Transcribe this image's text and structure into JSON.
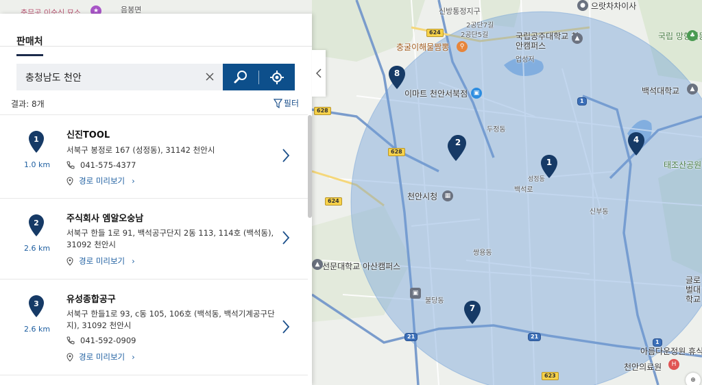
{
  "panel": {
    "tab_label": "판매처",
    "search_value": "충청남도 천안",
    "result_count": "결과: 8개",
    "filter_label": "필터"
  },
  "results": [
    {
      "number": "1",
      "name": "신진TOOL",
      "address": "서북구 봉정로 167 (성정동), 31142 천안시",
      "phone": "041-575-4377",
      "distance": "1.0 km",
      "route_label": "경로 미리보기"
    },
    {
      "number": "2",
      "name": "주식회사 엠알오숭남",
      "address": "서북구 한들 1로 91, 백석공구단지 2동 113, 114호 (백석동), 31092 천안시",
      "phone": "",
      "distance": "2.6 km",
      "route_label": "경로 미리보기"
    },
    {
      "number": "3",
      "name": "유성종합공구",
      "address": "서북구 한들1로 93, c동 105, 106호 (백석동, 백석기계공구단지), 31092 천안시",
      "phone": "041-592-0909",
      "distance": "2.6 km",
      "route_label": "경로 미리보기"
    }
  ],
  "map": {
    "labels": {
      "l01": "충무공 이순신 묘소",
      "l02": "음봉면",
      "l03": "신방통정지구",
      "l04": "2공단7길",
      "l05": "2공단5길",
      "l06": "충굴이해물짬뽕",
      "l07": "국립공주대학교 천안캠퍼스",
      "l08": "업성저",
      "l09": "으랏차차이사",
      "l10": "국립 망향의동산",
      "l11": "이마트 천안서북점",
      "l12": "백석대학교",
      "l13": "태조산공원",
      "l14": "천안시청",
      "l15": "성정동",
      "l16": "백석로",
      "l17": "선문대학교 아산캠퍼스",
      "l18": "글로벌대학교",
      "l19": "아름다운정원 휴식",
      "l20": "천안의료원",
      "l21": "불당동",
      "l22": "두정동",
      "l23": "신부동",
      "l24": "쌍용동"
    },
    "shields": {
      "s1": "624",
      "s2": "628",
      "s3": "628",
      "s4": "624",
      "s5": "21",
      "s6": "21",
      "s7": "1",
      "s8": "1",
      "s9": "623"
    },
    "pins": {
      "p1": "1",
      "p2": "2",
      "p3": "3",
      "p4": "4",
      "p7": "7",
      "p8": "8"
    }
  },
  "colors": {
    "primary": "#0d4f8b",
    "pin": "#163a66",
    "radius": "#6f9fd8"
  }
}
